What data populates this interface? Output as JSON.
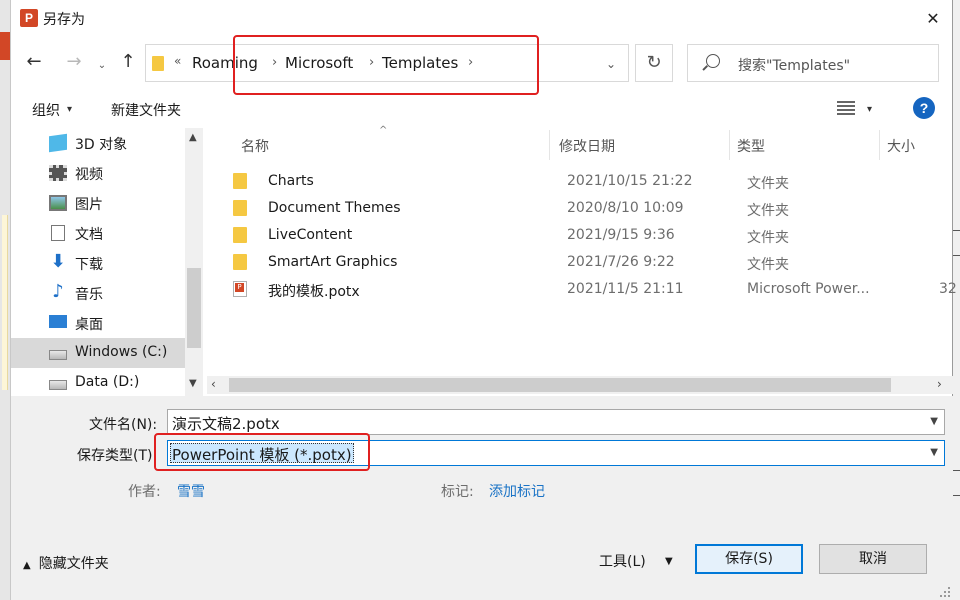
{
  "window": {
    "title": "另存为",
    "app_icon_letter": "P",
    "close_glyph": "✕"
  },
  "nav": {
    "back_glyph": "←",
    "forward_glyph": "→",
    "recent_glyph": "⌄",
    "up_glyph": "↑",
    "overflow_glyph": "«",
    "breadcrumbs": [
      "Roaming",
      "Microsoft",
      "Templates"
    ],
    "sep_glyph": "›",
    "dropdown_glyph": "⌄",
    "refresh_glyph": "↻",
    "search_placeholder": "搜索\"Templates\""
  },
  "toolbar": {
    "organize": "组织",
    "new_folder": "新建文件夹",
    "help": "?",
    "dropdown_glyph": "▾"
  },
  "sidebar": {
    "items": [
      {
        "label": "3D 对象",
        "icon": "cube-icon"
      },
      {
        "label": "视频",
        "icon": "video-icon"
      },
      {
        "label": "图片",
        "icon": "pictures-icon"
      },
      {
        "label": "文档",
        "icon": "documents-icon"
      },
      {
        "label": "下载",
        "icon": "download-icon"
      },
      {
        "label": "音乐",
        "icon": "music-icon"
      },
      {
        "label": "桌面",
        "icon": "desktop-icon"
      },
      {
        "label": "Windows (C:)",
        "icon": "drive-c-icon",
        "selected": true
      },
      {
        "label": "Data (D:)",
        "icon": "drive-d-icon"
      }
    ]
  },
  "columns": {
    "name": "名称",
    "date": "修改日期",
    "type": "类型",
    "size": "大小",
    "sort_glyph": "^"
  },
  "files": [
    {
      "name": "Charts",
      "date": "2021/10/15 21:22",
      "type": "文件夹",
      "size": "",
      "kind": "folder"
    },
    {
      "name": "Document Themes",
      "date": "2020/8/10 10:09",
      "type": "文件夹",
      "size": "",
      "kind": "folder"
    },
    {
      "name": "LiveContent",
      "date": "2021/9/15 9:36",
      "type": "文件夹",
      "size": "",
      "kind": "folder"
    },
    {
      "name": "SmartArt Graphics",
      "date": "2021/7/26 9:22",
      "type": "文件夹",
      "size": "",
      "kind": "folder"
    },
    {
      "name": "我的模板.potx",
      "date": "2021/11/5 21:11",
      "type": "Microsoft Power...",
      "size": "32",
      "kind": "potx"
    }
  ],
  "form": {
    "filename_label": "文件名(N):",
    "filename_value": "演示文稿2.potx",
    "filetype_label": "保存类型(T):",
    "filetype_value": "PowerPoint 模板 (*.potx)",
    "author_label": "作者:",
    "author_value": "雪雪",
    "tags_label": "标记:",
    "tags_value": "添加标记"
  },
  "footer": {
    "hide_folders": "隐藏文件夹",
    "tools": "工具(L)",
    "save": "保存(S)",
    "cancel": "取消"
  },
  "colors": {
    "accent": "#0078d7",
    "highlight_box": "#e02020",
    "app": "#d24726",
    "link": "#1a73c6"
  }
}
